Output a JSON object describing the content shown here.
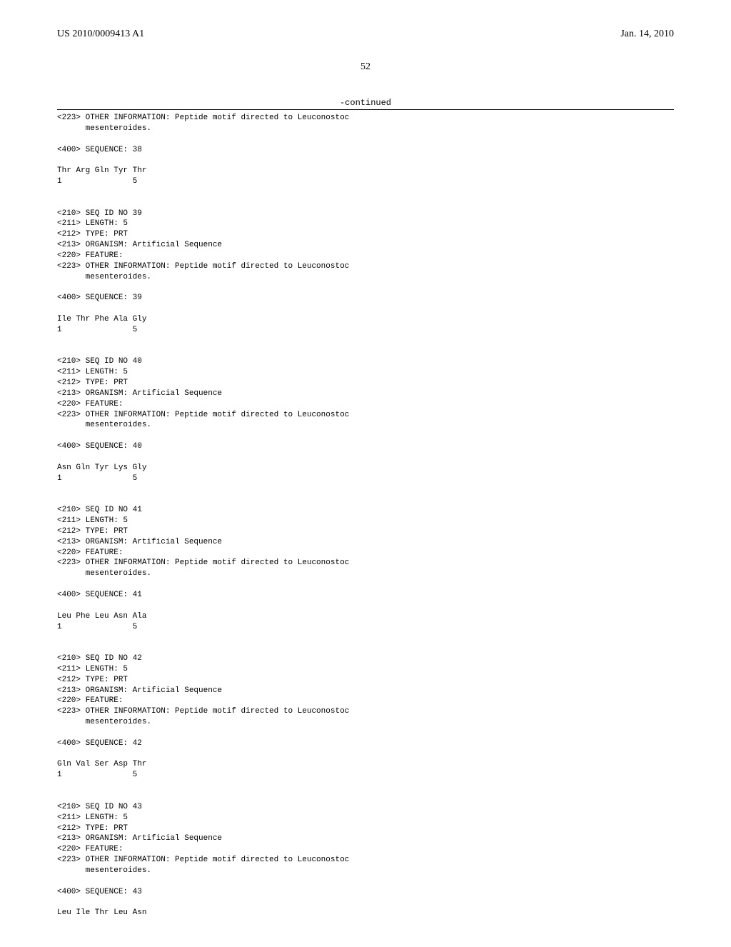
{
  "header": {
    "left": "US 2010/0009413 A1",
    "right": "Jan. 14, 2010"
  },
  "page_number": "52",
  "continued_label": "-continued",
  "listing": "<223> OTHER INFORMATION: Peptide motif directed to Leuconostoc\n      mesenteroides.\n\n<400> SEQUENCE: 38\n\nThr Arg Gln Tyr Thr\n1               5\n\n\n<210> SEQ ID NO 39\n<211> LENGTH: 5\n<212> TYPE: PRT\n<213> ORGANISM: Artificial Sequence\n<220> FEATURE:\n<223> OTHER INFORMATION: Peptide motif directed to Leuconostoc\n      mesenteroides.\n\n<400> SEQUENCE: 39\n\nIle Thr Phe Ala Gly\n1               5\n\n\n<210> SEQ ID NO 40\n<211> LENGTH: 5\n<212> TYPE: PRT\n<213> ORGANISM: Artificial Sequence\n<220> FEATURE:\n<223> OTHER INFORMATION: Peptide motif directed to Leuconostoc\n      mesenteroides.\n\n<400> SEQUENCE: 40\n\nAsn Gln Tyr Lys Gly\n1               5\n\n\n<210> SEQ ID NO 41\n<211> LENGTH: 5\n<212> TYPE: PRT\n<213> ORGANISM: Artificial Sequence\n<220> FEATURE:\n<223> OTHER INFORMATION: Peptide motif directed to Leuconostoc\n      mesenteroides.\n\n<400> SEQUENCE: 41\n\nLeu Phe Leu Asn Ala\n1               5\n\n\n<210> SEQ ID NO 42\n<211> LENGTH: 5\n<212> TYPE: PRT\n<213> ORGANISM: Artificial Sequence\n<220> FEATURE:\n<223> OTHER INFORMATION: Peptide motif directed to Leuconostoc\n      mesenteroides.\n\n<400> SEQUENCE: 42\n\nGln Val Ser Asp Thr\n1               5\n\n\n<210> SEQ ID NO 43\n<211> LENGTH: 5\n<212> TYPE: PRT\n<213> ORGANISM: Artificial Sequence\n<220> FEATURE:\n<223> OTHER INFORMATION: Peptide motif directed to Leuconostoc\n      mesenteroides.\n\n<400> SEQUENCE: 43\n\nLeu Ile Thr Leu Asn"
}
